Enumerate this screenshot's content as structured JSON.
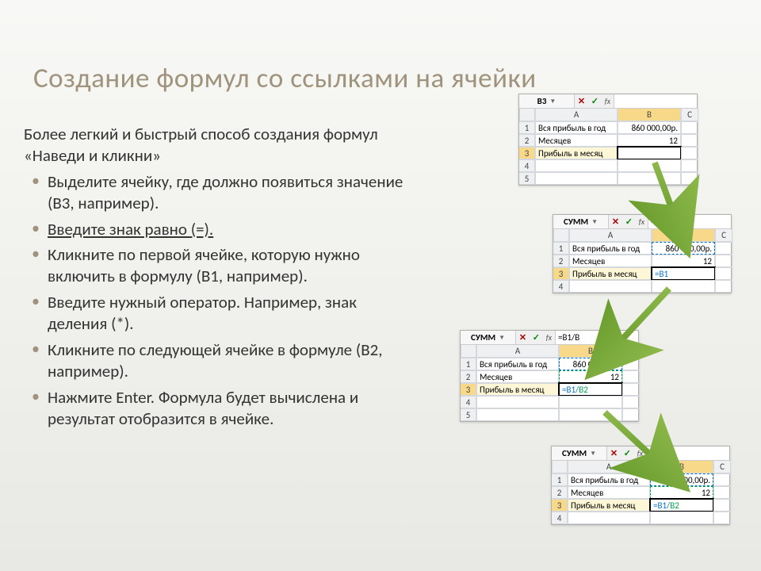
{
  "title": "Создание формул со ссылками на ячейки",
  "intro": "Более легкий и быстрый способ создания формул «Наведи и кликни»",
  "bullets": [
    "Выделите ячейку, где должно появиться значение (B3, например).",
    "Введите знак равно (=).",
    "Кликните по первой ячейке, которую нужно включить в формулу (B1, например).",
    "Введите нужный оператор. Например, знак деления (*).",
    "Кликните по следующей ячейке в формуле (B2, например).",
    "Нажмите Enter. Формула будет вычислена и результат отобразится в ячейке."
  ],
  "sheets": {
    "s1": {
      "name_box": "B3",
      "formula": "",
      "cols": [
        "A",
        "B",
        "C"
      ],
      "rows": [
        {
          "n": "1",
          "a": "Вся прибыль в год",
          "b": "860 000,00р."
        },
        {
          "n": "2",
          "a": "Месяцев",
          "b": "12"
        },
        {
          "n": "3",
          "a": "Прибыль в месяц",
          "b": ""
        },
        {
          "n": "4",
          "a": "",
          "b": ""
        },
        {
          "n": "5",
          "a": "",
          "b": ""
        }
      ]
    },
    "s2": {
      "name_box": "СУММ",
      "formula": "=B1",
      "cols": [
        "A",
        "B",
        "C"
      ],
      "rows": [
        {
          "n": "1",
          "a": "Вся прибыль в год",
          "b": "860 000,00р."
        },
        {
          "n": "2",
          "a": "Месяцев",
          "b": "12"
        },
        {
          "n": "3",
          "a": "Прибыль в месяц",
          "b": "=B1"
        },
        {
          "n": "4",
          "a": "",
          "b": ""
        }
      ]
    },
    "s3": {
      "name_box": "СУММ",
      "formula_prefix": "=B1/",
      "formula_ref": "B",
      "cols": [
        "A",
        "B",
        "C"
      ],
      "b3_left": "=B1/",
      "b3_right": "B2",
      "rows": [
        {
          "n": "1",
          "a": "Вся прибыль в год",
          "b": "860 000,00р."
        },
        {
          "n": "2",
          "a": "Месяцев",
          "b": "12"
        },
        {
          "n": "3",
          "a": "Прибыль в месяц",
          "b": ""
        },
        {
          "n": "4",
          "a": "",
          "b": ""
        },
        {
          "n": "5",
          "a": "",
          "b": ""
        }
      ]
    },
    "s4": {
      "name_box": "СУММ",
      "formula": "=B1/B2",
      "cols": [
        "A",
        "B",
        "C"
      ],
      "b3_left": "=B1/",
      "b3_right": "B2",
      "rows": [
        {
          "n": "1",
          "a": "Вся прибыль в год",
          "b": "860 000,00р."
        },
        {
          "n": "2",
          "a": "Месяцев",
          "b": "12"
        },
        {
          "n": "3",
          "a": "Прибыль в месяц",
          "b": ""
        },
        {
          "n": "4",
          "a": "",
          "b": ""
        }
      ]
    }
  }
}
